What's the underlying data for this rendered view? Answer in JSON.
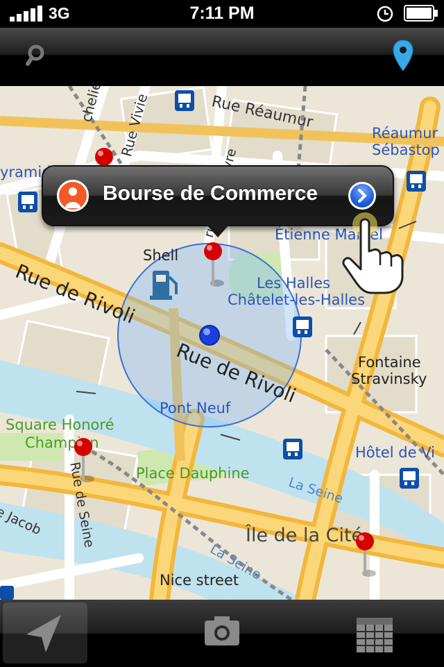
{
  "status_bar": {
    "carrier": "3G",
    "time": "7:11 PM"
  },
  "nav_bar": {
    "left_icon": "search-icon",
    "right_icon": "location-pin-icon"
  },
  "callout": {
    "title": "Bourse de Commerce",
    "left_icon": "person-icon",
    "right_icon": "detail-disclosure-icon"
  },
  "map": {
    "labels": {
      "rue_reaumur": "Rue Réaumur",
      "reaumur_sebastopol_1": "Réaumur",
      "reaumur_sebastopol_2": "Sébastop",
      "pyramides": "yramides",
      "chelieu": "chelieu",
      "rue_vivie": "Rue Vivie",
      "rue_du_louvre": "rue du Louvre",
      "etienne_marcel": "Étienne Marcel",
      "shell": "Shell",
      "les_halles": "Les Halles",
      "chatelet": "Châtelet-les-Halles",
      "rue_de_rivoli_1": "Rue de Rivoli",
      "rue_de_rivoli_2": "Rue de Rivoli",
      "fontaine_1": "Fontaine",
      "fontaine_2": "Stravinsky",
      "pont_neuf": "Pont Neuf",
      "square_1": "Square Honoré",
      "square_2": "Champion",
      "hotel_de_ville": "Hôtel de Vi",
      "place_dauphine": "Place Dauphine",
      "la_seine_1": "La Seine",
      "la_seine_2": "La Seine",
      "rue_de_seine": "Rue de Seine",
      "jacob": "e Jacob",
      "ile_de_la_cite": "Île de la Cité",
      "nice_street": "Nice street"
    }
  },
  "tab_bar": {
    "tabs": [
      {
        "icon": "navigation-arrow-icon",
        "selected": true
      },
      {
        "icon": "camera-icon",
        "selected": false
      },
      {
        "icon": "calendar-icon",
        "selected": false
      }
    ]
  },
  "colors": {
    "major_road": "#f7c04a",
    "minor_road": "#ffffff",
    "water": "#bfe2ef",
    "block": "#e8e3d6",
    "park": "#cfe8b0",
    "pin_red": "#d40000",
    "user_dot": "#1a3fe0",
    "metro": "#0d4fa8"
  }
}
